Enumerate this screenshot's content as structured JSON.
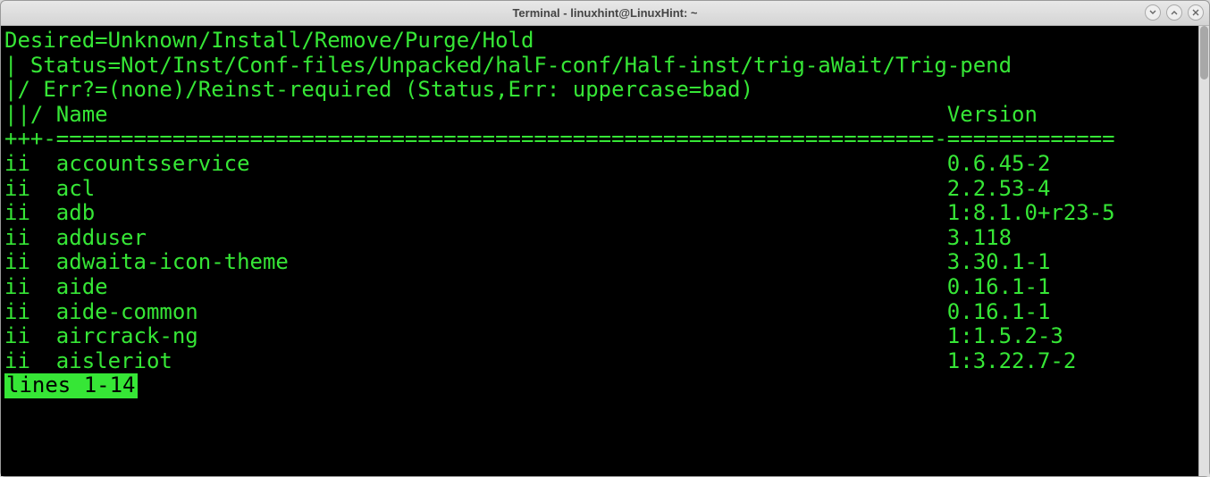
{
  "window": {
    "title": "Terminal - linuxhint@LinuxHint: ~"
  },
  "terminal": {
    "header_lines": [
      "Desired=Unknown/Install/Remove/Purge/Hold",
      "| Status=Not/Inst/Conf-files/Unpacked/halF-conf/Half-inst/trig-aWait/Trig-pend",
      "|/ Err?=(none)/Reinst-required (Status,Err: uppercase=bad)",
      "||/ Name                                                                 Version",
      "+++-====================================================================-============="
    ],
    "packages": [
      {
        "status": "ii",
        "name": "accountsservice",
        "version": "0.6.45-2"
      },
      {
        "status": "ii",
        "name": "acl",
        "version": "2.2.53-4"
      },
      {
        "status": "ii",
        "name": "adb",
        "version": "1:8.1.0+r23-5"
      },
      {
        "status": "ii",
        "name": "adduser",
        "version": "3.118"
      },
      {
        "status": "ii",
        "name": "adwaita-icon-theme",
        "version": "3.30.1-1"
      },
      {
        "status": "ii",
        "name": "aide",
        "version": "0.16.1-1"
      },
      {
        "status": "ii",
        "name": "aide-common",
        "version": "0.16.1-1"
      },
      {
        "status": "ii",
        "name": "aircrack-ng",
        "version": "1:1.5.2-3"
      },
      {
        "status": "ii",
        "name": "aisleriot",
        "version": "1:3.22.7-2"
      }
    ],
    "status_text": "lines 1-14"
  },
  "colors": {
    "term_bg": "#000000",
    "term_fg": "#36e636"
  }
}
